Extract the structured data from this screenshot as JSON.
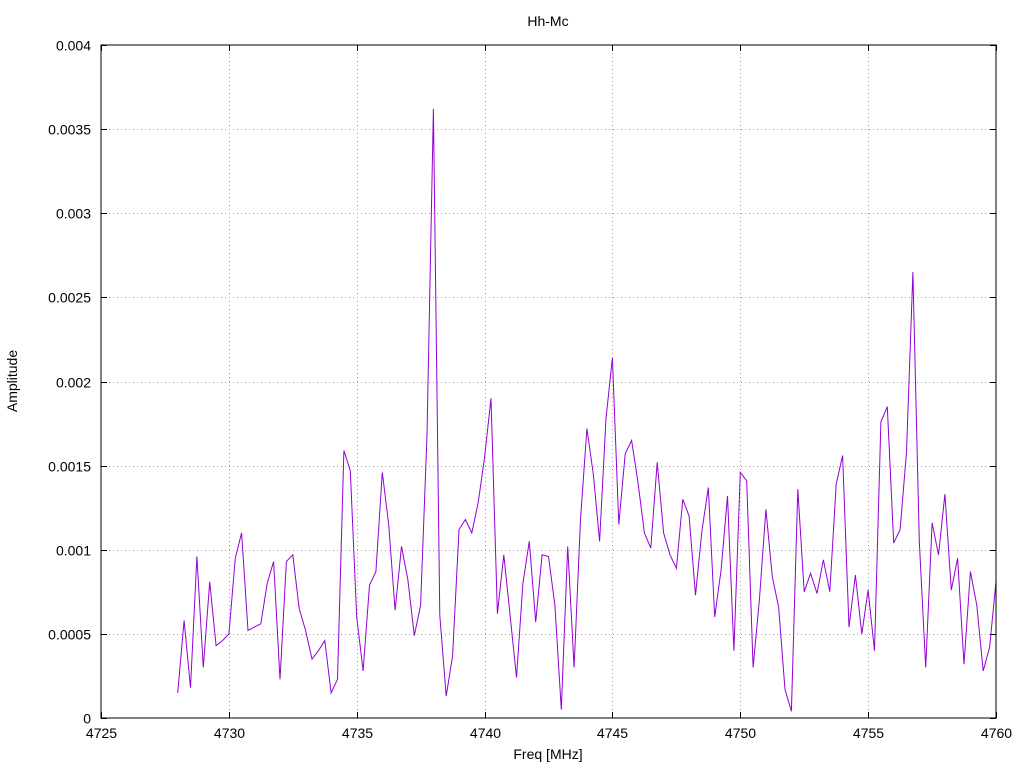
{
  "chart_data": {
    "type": "line",
    "title": "Hh-Mc",
    "xlabel": "Freq [MHz]",
    "ylabel": "Amplitude",
    "xlim": [
      4725,
      4760
    ],
    "ylim": [
      0,
      0.004
    ],
    "x_ticks": [
      4725,
      4730,
      4735,
      4740,
      4745,
      4750,
      4755,
      4760
    ],
    "x_tick_labels": [
      "4725",
      "4730",
      "4735",
      "4740",
      "4745",
      "4750",
      "4755",
      "4760"
    ],
    "y_ticks": [
      0,
      0.0005,
      0.001,
      0.0015,
      0.002,
      0.0025,
      0.003,
      0.0035,
      0.004
    ],
    "y_tick_labels": [
      "0",
      "0.0005",
      "0.001",
      "0.0015",
      "0.002",
      "0.0025",
      "0.003",
      "0.0035",
      "0.004"
    ],
    "grid": true,
    "line_color": "#9400d3",
    "series": [
      {
        "x": [
          4728.0,
          4728.25,
          4728.5,
          4728.75,
          4729.0,
          4729.25,
          4729.5,
          4729.75,
          4730.0,
          4730.25,
          4730.5,
          4730.75,
          4731.0,
          4731.25,
          4731.5,
          4731.75,
          4732.0,
          4732.25,
          4732.5,
          4732.75,
          4733.0,
          4733.25,
          4733.5,
          4733.75,
          4734.0,
          4734.25,
          4734.5,
          4734.75,
          4735.0,
          4735.25,
          4735.5,
          4735.75,
          4736.0,
          4736.25,
          4736.5,
          4736.75,
          4737.0,
          4737.25,
          4737.5,
          4737.75,
          4738.0,
          4738.25,
          4738.5,
          4738.75,
          4739.0,
          4739.25,
          4739.5,
          4739.75,
          4740.0,
          4740.25,
          4740.5,
          4740.75,
          4741.0,
          4741.25,
          4741.5,
          4741.75,
          4742.0,
          4742.25,
          4742.5,
          4742.75,
          4743.0,
          4743.25,
          4743.5,
          4743.75,
          4744.0,
          4744.25,
          4744.5,
          4744.75,
          4745.0,
          4745.25,
          4745.5,
          4745.75,
          4746.0,
          4746.25,
          4746.5,
          4746.75,
          4747.0,
          4747.25,
          4747.5,
          4747.75,
          4748.0,
          4748.25,
          4748.5,
          4748.75,
          4749.0,
          4749.25,
          4749.5,
          4749.75,
          4750.0,
          4750.25,
          4750.5,
          4750.75,
          4751.0,
          4751.25,
          4751.5,
          4751.75,
          4752.0,
          4752.25,
          4752.5,
          4752.75,
          4753.0,
          4753.25,
          4753.5,
          4753.75,
          4754.0,
          4754.25,
          4754.5,
          4754.75,
          4755.0,
          4755.25,
          4755.5,
          4755.75,
          4756.0,
          4756.25,
          4756.5,
          4756.75,
          4757.0,
          4757.25,
          4757.5,
          4757.75,
          4758.0,
          4758.25,
          4758.5,
          4758.75,
          4759.0,
          4759.25,
          4759.5,
          4759.75,
          4760.0
        ],
        "y": [
          0.00015,
          0.00058,
          0.00018,
          0.00096,
          0.0003,
          0.00081,
          0.00043,
          0.00046,
          0.0005,
          0.00095,
          0.0011,
          0.00052,
          0.00054,
          0.00056,
          0.0008,
          0.00093,
          0.00023,
          0.00093,
          0.00097,
          0.00065,
          0.00052,
          0.00035,
          0.0004,
          0.00046,
          0.00015,
          0.00023,
          0.00159,
          0.00147,
          0.0006,
          0.00028,
          0.00079,
          0.00087,
          0.00146,
          0.00115,
          0.00064,
          0.00102,
          0.00082,
          0.00049,
          0.00067,
          0.00168,
          0.00362,
          0.00061,
          0.00013,
          0.00037,
          0.00112,
          0.00118,
          0.0011,
          0.00128,
          0.00155,
          0.0019,
          0.00062,
          0.00097,
          0.00061,
          0.00024,
          0.0008,
          0.00105,
          0.00057,
          0.00097,
          0.00096,
          0.00067,
          5e-05,
          0.00102,
          0.0003,
          0.00118,
          0.00172,
          0.00145,
          0.00105,
          0.00178,
          0.00214,
          0.00115,
          0.00157,
          0.00165,
          0.0014,
          0.0011,
          0.00101,
          0.00152,
          0.0011,
          0.00097,
          0.00089,
          0.0013,
          0.0012,
          0.00073,
          0.00111,
          0.00137,
          0.0006,
          0.00088,
          0.00132,
          0.0004,
          0.00146,
          0.00141,
          0.0003,
          0.00071,
          0.00124,
          0.00084,
          0.00066,
          0.00017,
          4e-05,
          0.00136,
          0.00075,
          0.00086,
          0.00074,
          0.00094,
          0.00075,
          0.00139,
          0.00156,
          0.00054,
          0.00085,
          0.0005,
          0.00076,
          0.0004,
          0.00176,
          0.00185,
          0.00104,
          0.00112,
          0.00158,
          0.00265,
          0.00105,
          0.0003,
          0.00116,
          0.00097,
          0.00133,
          0.00076,
          0.00095,
          0.00032,
          0.00087,
          0.00067,
          0.00028,
          0.00042,
          0.00081
        ]
      }
    ]
  }
}
